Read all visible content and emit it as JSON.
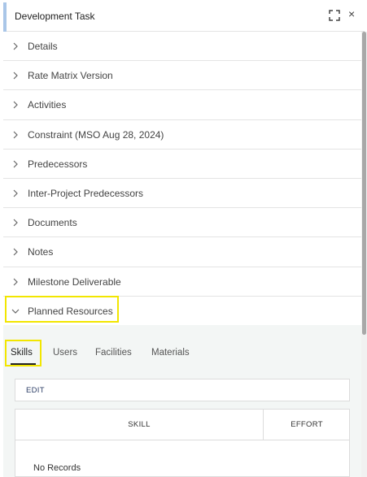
{
  "header": {
    "title": "Development Task",
    "expand_icon": "expand-icon",
    "close_icon": "close-icon",
    "close_glyph": "×"
  },
  "sections": [
    {
      "label": "Details",
      "expanded": false
    },
    {
      "label": "Rate Matrix Version",
      "expanded": false
    },
    {
      "label": "Activities",
      "expanded": false
    },
    {
      "label": "Constraint (MSO Aug 28, 2024)",
      "expanded": false
    },
    {
      "label": "Predecessors",
      "expanded": false
    },
    {
      "label": "Inter-Project Predecessors",
      "expanded": false
    },
    {
      "label": "Documents",
      "expanded": false
    },
    {
      "label": "Notes",
      "expanded": false
    },
    {
      "label": "Milestone Deliverable",
      "expanded": false
    },
    {
      "label": "Planned Resources",
      "expanded": true
    }
  ],
  "planned_resources": {
    "tabs": [
      {
        "label": "Skills",
        "active": true
      },
      {
        "label": "Users",
        "active": false
      },
      {
        "label": "Facilities",
        "active": false
      },
      {
        "label": "Materials",
        "active": false
      }
    ],
    "edit_label": "EDIT",
    "table": {
      "columns": [
        "SKILL",
        "EFFORT"
      ],
      "empty_text": "No Records"
    }
  },
  "colors": {
    "highlight": "#f2e600",
    "accent": "#a9c6e8",
    "subpanel_bg": "#f3f6f5"
  }
}
